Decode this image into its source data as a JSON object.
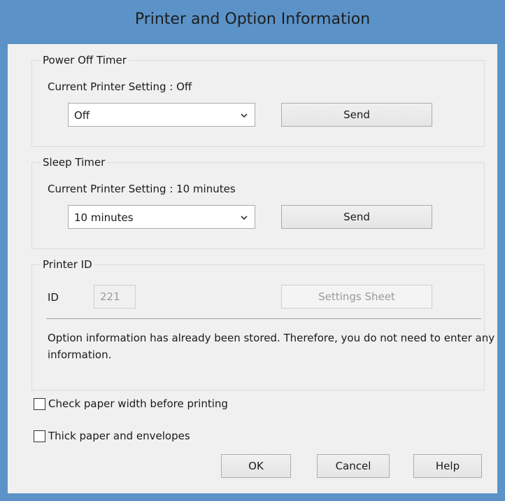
{
  "window": {
    "title": "Printer and Option Information"
  },
  "power_off_timer": {
    "legend": "Power Off Timer",
    "current_setting": "Current Printer Setting : Off",
    "selected": "Off",
    "send_label": "Send"
  },
  "sleep_timer": {
    "legend": "Sleep Timer",
    "current_setting": "Current Printer Setting : 10 minutes",
    "selected": "10 minutes",
    "send_label": "Send"
  },
  "printer_id": {
    "legend": "Printer ID",
    "id_label": "ID",
    "id_value": "221",
    "settings_sheet_label": "Settings Sheet",
    "message": "Option information has already been stored. Therefore, you do not need to enter any information."
  },
  "options": {
    "check_paper_width": {
      "label": "Check paper width before printing",
      "checked": false
    },
    "thick_paper": {
      "label": "Thick paper and envelopes",
      "checked": false
    }
  },
  "buttons": {
    "ok": "OK",
    "cancel": "Cancel",
    "help": "Help"
  }
}
